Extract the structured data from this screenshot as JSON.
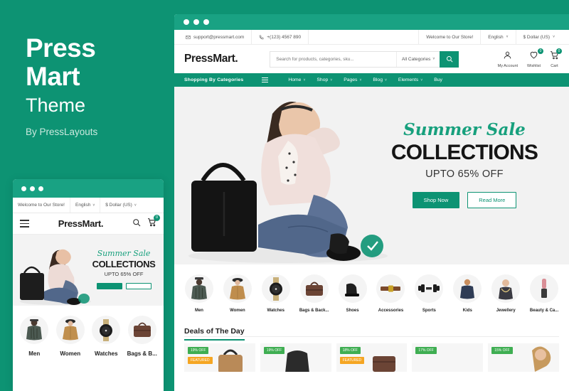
{
  "promo": {
    "title_line1": "Press",
    "title_line2": "Mart",
    "subtitle": "Theme",
    "byline": "By PressLayouts",
    "brand_green": "#0d9373",
    "accent_green": "#17a07d"
  },
  "mobile_preview": {
    "topbar": {
      "welcome": "Welcome to Our Store!",
      "language": "English",
      "currency": "$ Dollar (US)",
      "caret": "˅"
    },
    "header": {
      "logo": "PressMart.",
      "cart_count": "0"
    },
    "hero": {
      "script": "Summer Sale",
      "headline": "COLLECTIONS",
      "subline": "UPTO 65% OFF"
    },
    "categories": [
      {
        "label": "Men"
      },
      {
        "label": "Women"
      },
      {
        "label": "Watches"
      },
      {
        "label": "Bags & B..."
      }
    ]
  },
  "browser": {
    "topbar": {
      "email": "support@pressmart.com",
      "phone": "+(123) 4567 890",
      "welcome": "Welcome to Our Store!",
      "language": "English",
      "currency": "$ Dollar (US)",
      "caret": "˅"
    },
    "header": {
      "logo": "PressMart.",
      "search_placeholder": "Search for products, categories, sku...",
      "category_select": "All Categories",
      "actions": [
        {
          "label": "My Account",
          "badge": ""
        },
        {
          "label": "Wishlist",
          "badge": "0"
        },
        {
          "label": "Cart",
          "badge": "0"
        }
      ]
    },
    "nav": {
      "categories_label": "Shopping By Categories",
      "links": [
        {
          "label": "Home",
          "has_caret": true
        },
        {
          "label": "Shop",
          "has_caret": true
        },
        {
          "label": "Pages",
          "has_caret": true
        },
        {
          "label": "Blog",
          "has_caret": true
        },
        {
          "label": "Elements",
          "has_caret": true
        },
        {
          "label": "Buy",
          "has_caret": false
        }
      ]
    },
    "hero": {
      "script": "Summer Sale",
      "headline": "COLLECTIONS",
      "subline": "UPTO 65% OFF",
      "button_primary": "Shop Now",
      "button_secondary": "Read More"
    },
    "categories": [
      {
        "label": "Men"
      },
      {
        "label": "Women"
      },
      {
        "label": "Watches"
      },
      {
        "label": "Bags & Back..."
      },
      {
        "label": "Shoes"
      },
      {
        "label": "Accessories"
      },
      {
        "label": "Sports"
      },
      {
        "label": "Kids"
      },
      {
        "label": "Jewellery"
      },
      {
        "label": "Beauty & Ca..."
      }
    ],
    "deals": {
      "title": "Deals of The Day",
      "items": [
        {
          "discount": "19% OFF",
          "secondary": "FEATURED"
        },
        {
          "discount": "19% OFF",
          "secondary": ""
        },
        {
          "discount": "18% OFF",
          "secondary": "FEATURED"
        },
        {
          "discount": "17% OFF",
          "secondary": ""
        },
        {
          "discount": "15% OFF",
          "secondary": ""
        }
      ]
    }
  }
}
